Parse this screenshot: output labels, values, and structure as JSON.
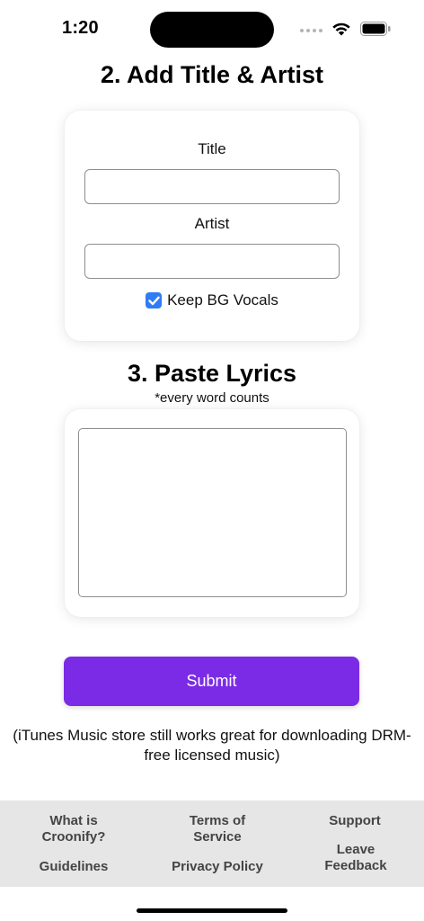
{
  "status_bar": {
    "time": "1:20"
  },
  "section2": {
    "heading": "2. Add Title & Artist",
    "title_label": "Title",
    "title_value": "",
    "artist_label": "Artist",
    "artist_value": "",
    "keep_bg_vocals_label": "Keep BG Vocals",
    "keep_bg_vocals_checked": true
  },
  "section3": {
    "heading": "3. Paste Lyrics",
    "subheading": "*every word counts",
    "lyrics_value": ""
  },
  "submit_label": "Submit",
  "note": "(iTunes Music store still works great for downloading DRM-free licensed music)",
  "footer": {
    "what_is": "What is Croonify?",
    "terms": "Terms of Service",
    "support": "Support",
    "guidelines": "Guidelines",
    "privacy": "Privacy Policy",
    "feedback": "Leave Feedback"
  },
  "colors": {
    "accent": "#7b2be6",
    "checkbox": "#2f7cf6",
    "footer_bg": "#e6e6e6"
  }
}
